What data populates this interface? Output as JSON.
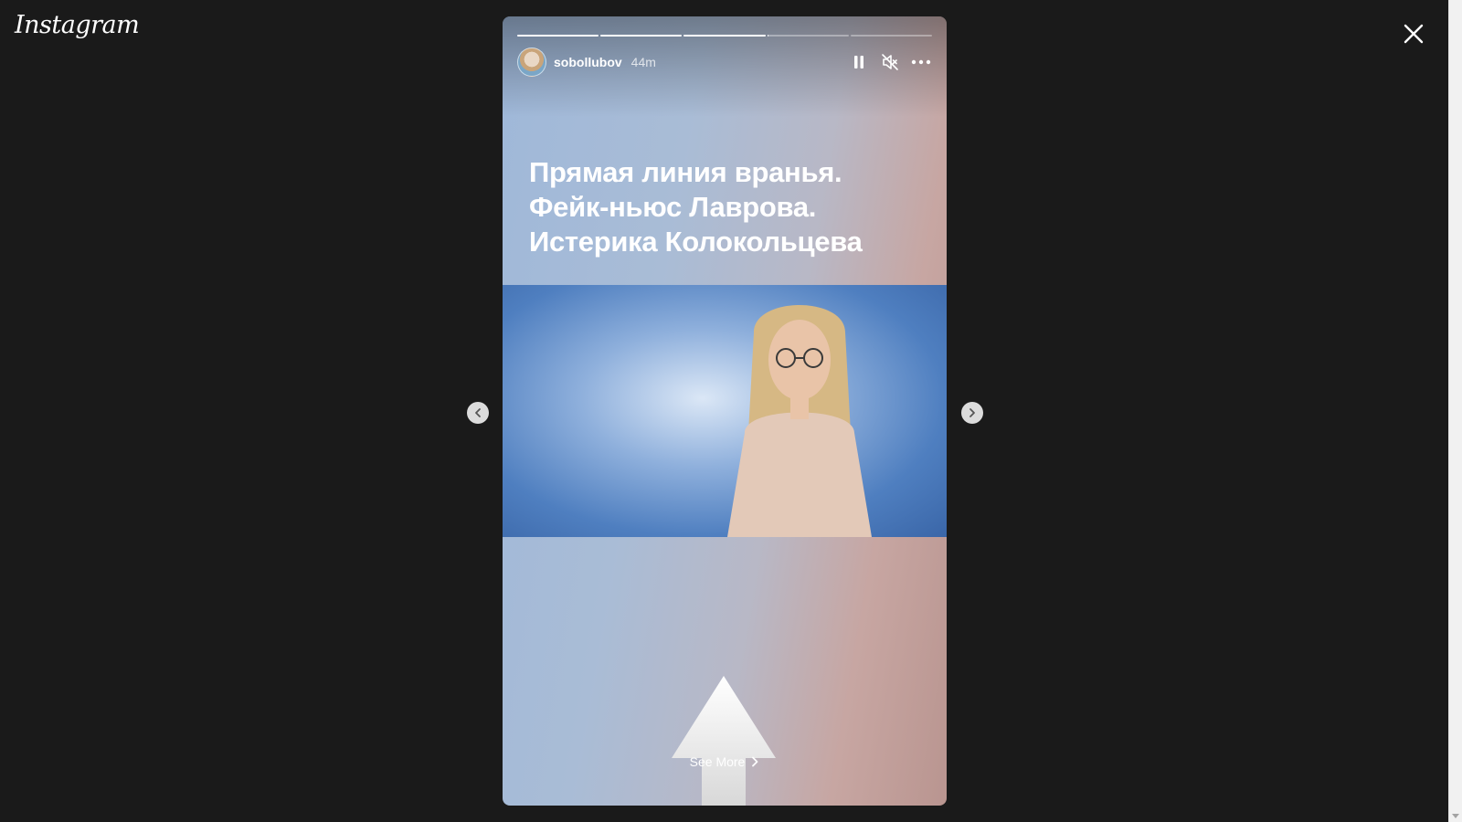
{
  "app": {
    "logo_text": "Instagram"
  },
  "story": {
    "progress_segments": [
      1,
      1,
      1,
      0.02,
      0
    ],
    "username": "sobollubov",
    "time_ago": "44m",
    "headline_lines": [
      "Прямая линия вранья.",
      "Фейк-ньюс Лаврова.",
      "Истерика Колокольцева"
    ],
    "see_more_label": "See More"
  },
  "icons": {
    "close": "close-icon",
    "pause": "pause-icon",
    "mute": "mute-icon",
    "more": "more-options-icon",
    "prev": "chevron-left-icon",
    "next": "chevron-right-icon",
    "see_more_chevron": "chevron-right-icon"
  },
  "colors": {
    "background": "#1a1a1a",
    "text": "#ffffff"
  }
}
